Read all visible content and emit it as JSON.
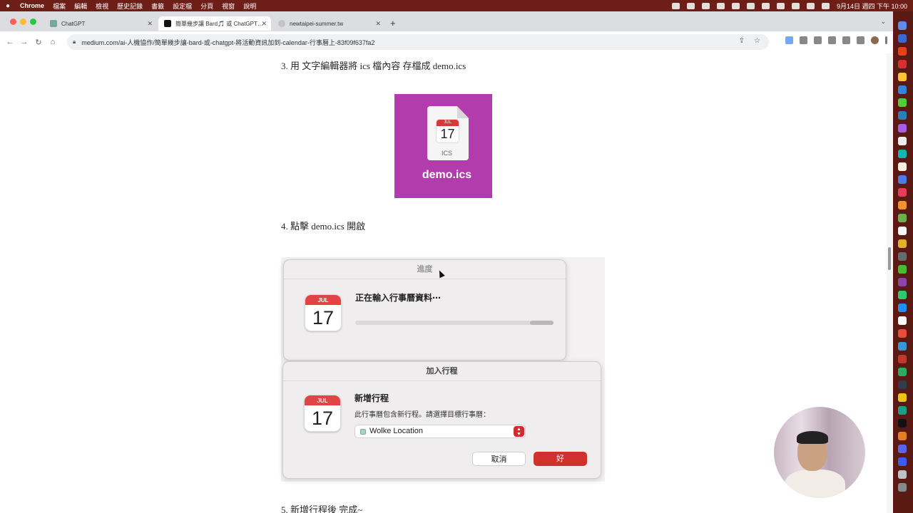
{
  "menubar": {
    "apple": "",
    "items": [
      "Chrome",
      "檔案",
      "編輯",
      "檢視",
      "歷史記錄",
      "書籤",
      "設定檔",
      "分頁",
      "視窗",
      "說明"
    ],
    "clock": "9月14日 週四 下午 10:00"
  },
  "tabs": [
    {
      "title": "ChatGPT"
    },
    {
      "title": "簡單幾步讓 Bard🎵 或 ChatGPT…"
    },
    {
      "title": "newtaipei-summer.tw"
    }
  ],
  "toolbar": {
    "url": "medium.com/ai-人機協作/簡單幾步讓-bard-或-chatgpt-將活動資訊加到-calendar-行事曆上-83f09f637fa2"
  },
  "article": {
    "step3": "3. 用 文字編輯器將 ics 檔內容 存檔成 demo.ics",
    "step4": "4. 點擊 demo.ics 開啟",
    "step5": "5. 新增行程後 完成~",
    "ics_image": {
      "month": "JUL",
      "day": "17",
      "type_label": "ICS",
      "filename": "demo.ics"
    },
    "progress_dialog": {
      "title": "進度",
      "message": "正在輸入行事曆資料⋯",
      "month": "JUL",
      "day": "17",
      "progress_fraction": 0.12
    },
    "add_event_dialog": {
      "title": "加入行程",
      "heading": "新增行程",
      "message": "此行事曆包含新行程。請選擇目標行事曆：",
      "month": "JUL",
      "day": "17",
      "selected_calendar": "Wolke Location",
      "cancel_label": "取消",
      "ok_label": "好"
    }
  },
  "colors": {
    "menubar": "#6d1f17",
    "ics_background": "#b23cab",
    "calendar_red": "#e04444",
    "ok_button": "#d0312d"
  }
}
